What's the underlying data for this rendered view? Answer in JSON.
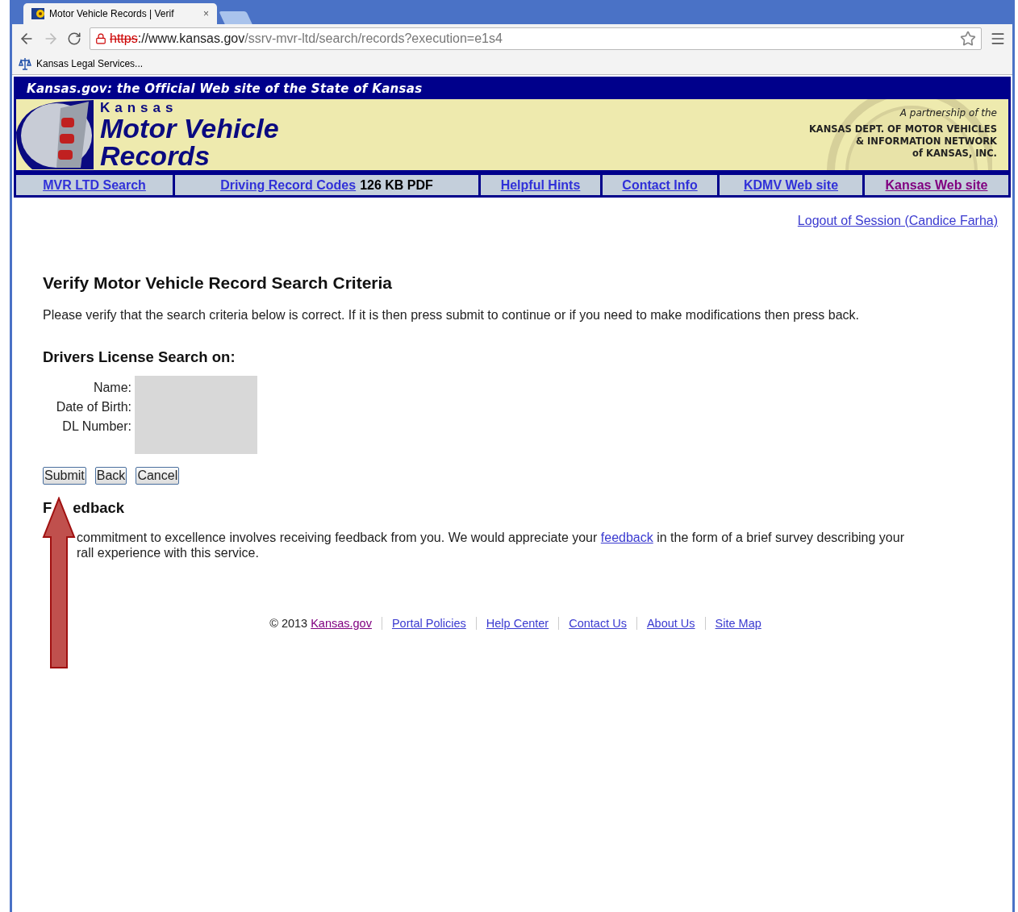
{
  "browser": {
    "tab_title": "Motor Vehicle Records | Verif",
    "tab_close": "×",
    "url_scheme": "https",
    "url_host": "://www.kansas.gov",
    "url_path": "/ssrv-mvr-ltd/search/records?execution=e1s4",
    "bookmarks": [
      "Kansas Legal Services..."
    ]
  },
  "site": {
    "top_bar": "Kansas.gov: the Official Web site of the State of Kansas",
    "logo_small": "Kansas",
    "logo_title_1": "Motor Vehicle",
    "logo_title_2": "Records",
    "partnership": "A partnership of the",
    "partner_lines": [
      "KANSAS DEPT. OF MOTOR VEHICLES",
      "& INFORMATION NETWORK",
      "of KANSAS, INC."
    ]
  },
  "nav": [
    {
      "label": "MVR LTD Search",
      "visited": false
    },
    {
      "label": "Driving Record Codes",
      "suffix": "126 KB PDF",
      "visited": false
    },
    {
      "label": "Helpful Hints",
      "visited": false
    },
    {
      "label": "Contact Info",
      "visited": false
    },
    {
      "label": "KDMV Web site",
      "visited": false
    },
    {
      "label": "Kansas Web site",
      "visited": true
    }
  ],
  "logout": "Logout of Session (Candice Farha)",
  "heading": "Verify Motor Vehicle Record Search Criteria",
  "intro": "Please verify that the search criteria below is correct. If it is then press submit to continue or if you need to make modifications then press back.",
  "search_heading": "Drivers License Search on:",
  "fields": [
    {
      "label": "Name:"
    },
    {
      "label": "Date of Birth:"
    },
    {
      "label": "DL Number:"
    }
  ],
  "buttons": [
    "Submit",
    "Back",
    "Cancel"
  ],
  "feedback": {
    "heading_start": "F",
    "heading_end": "edback",
    "text_before": "commitment to excellence involves receiving feedback from you. We would appreciate your ",
    "link": "feedback",
    "text_after": " in the form of a brief survey describing your",
    "line_2": "rall experience with this service."
  },
  "footer": {
    "copyright": "© 2013",
    "links": [
      {
        "label": "Kansas.gov",
        "visited": true
      },
      {
        "label": "Portal Policies",
        "visited": false
      },
      {
        "label": "Help Center",
        "visited": false
      },
      {
        "label": "Contact Us",
        "visited": false
      },
      {
        "label": "About Us",
        "visited": false
      },
      {
        "label": "Site Map",
        "visited": false
      }
    ]
  }
}
